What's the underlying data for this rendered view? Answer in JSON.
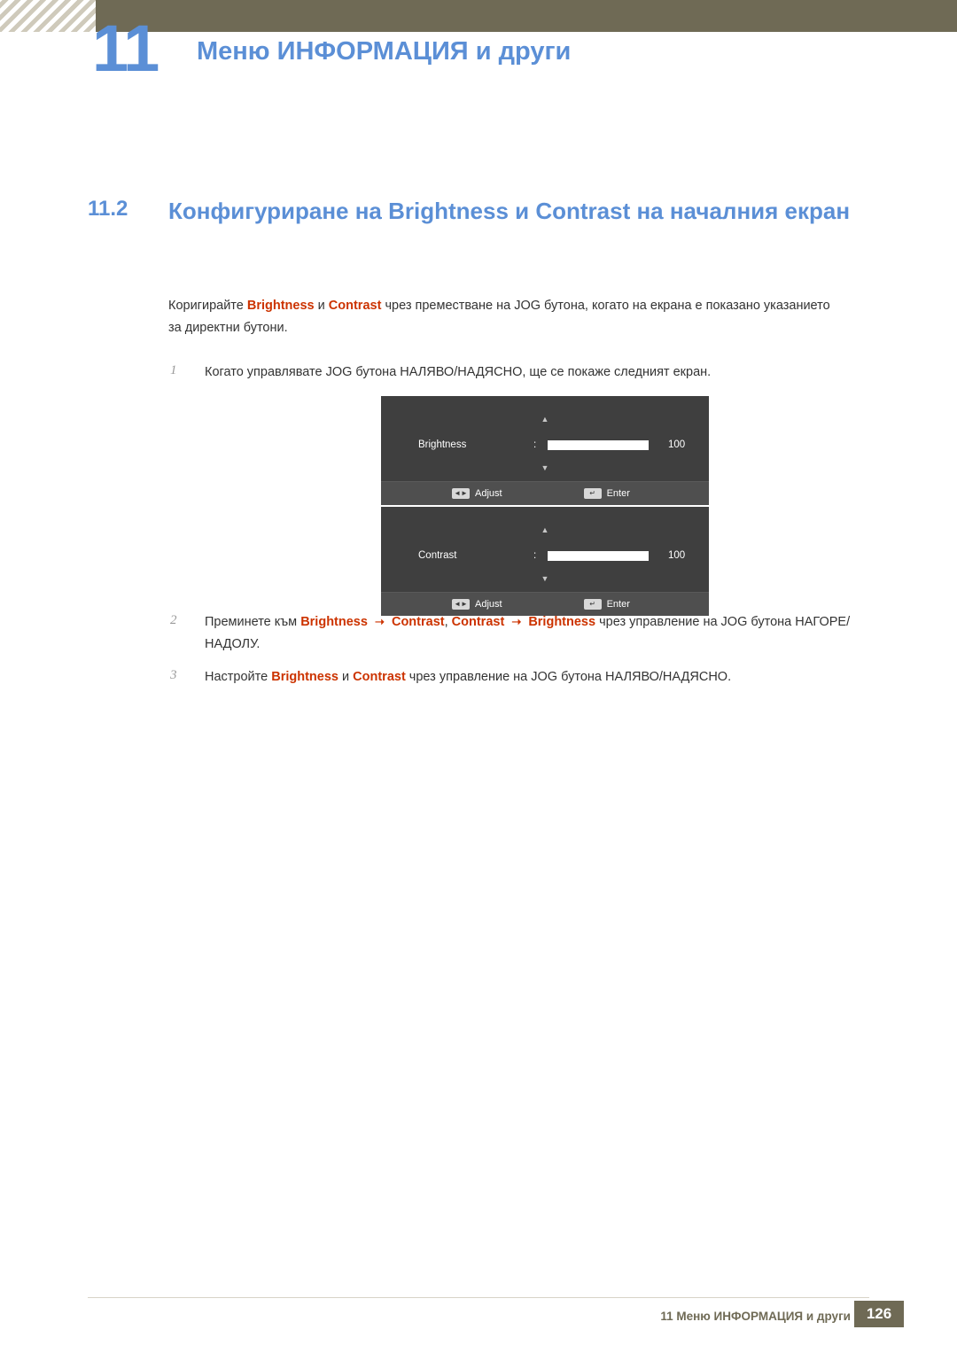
{
  "header": {
    "chapter_number": "11",
    "title": "Меню ИНФОРМАЦИЯ и други"
  },
  "section": {
    "number": "11.2",
    "title": "Конфигуриране на Brightness и Contrast на началния екран"
  },
  "intro": {
    "part1": "Коригирайте ",
    "bold1": "Brightness",
    "part2": " и ",
    "bold2": "Contrast",
    "part3": " чрез преместване на JOG бутона, когато на екрана е показано указанието за директни бутони."
  },
  "steps": {
    "one_num": "1",
    "one_text": "Когато управлявате JOG бутона НАЛЯВО/НАДЯСНО, ще се покаже следният екран.",
    "two_num": "2",
    "two_a": "Преминете към ",
    "two_b": "Brightness",
    "two_arrow1": "➝",
    "two_c": "Contrast",
    "two_d": ", ",
    "two_e": "Contrast",
    "two_arrow2": "➝",
    "two_f": "Brightness",
    "two_g": " чрез управление на JOG бутона НАГОРЕ/НАДОЛУ.",
    "three_num": "3",
    "three_a": "Настройте ",
    "three_b": "Brightness",
    "three_c": " и ",
    "three_d": "Contrast",
    "three_e": " чрез управление на JOG бутона НАЛЯВО/НАДЯСНО."
  },
  "osd": [
    {
      "arrow_up": "▲",
      "label": "Brightness",
      "colon": ":",
      "value": "100",
      "arrow_down": "▼",
      "adjust_key": "◄►",
      "adjust_label": "Adjust",
      "enter_key": "↵",
      "enter_label": "Enter"
    },
    {
      "arrow_up": "▲",
      "label": "Contrast",
      "colon": ":",
      "value": "100",
      "arrow_down": "▼",
      "adjust_key": "◄►",
      "adjust_label": "Adjust",
      "enter_key": "↵",
      "enter_label": "Enter"
    }
  ],
  "footer": {
    "text": "11 Меню ИНФОРМАЦИЯ и други",
    "page": "126"
  },
  "colors": {
    "accent_blue": "#5b8fd6",
    "accent_red": "#cc3300",
    "band_olive": "#6f6a55"
  }
}
